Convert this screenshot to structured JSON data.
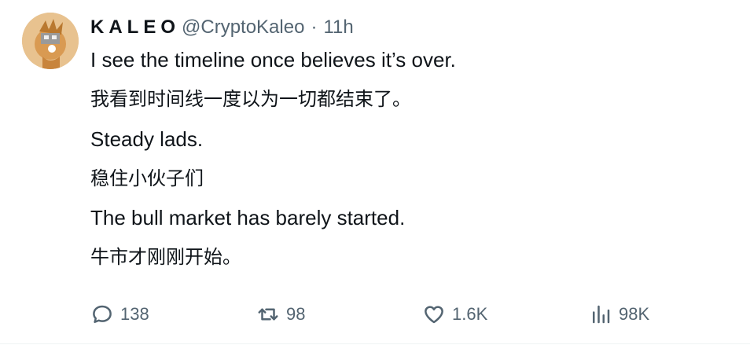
{
  "tweet": {
    "author": {
      "name": "KALEO",
      "handle": "@CryptoKaleo",
      "separator": "·",
      "time": "11h"
    },
    "lines": [
      "I see the timeline once believes it’s over.",
      "我看到时间线一度以为一切都结束了。",
      "Steady lads.",
      "稳住小伙子们",
      "The bull market has barely started.",
      "牛市才刚刚开始。"
    ],
    "actions": {
      "replies": "138",
      "retweets": "98",
      "likes": "1.6K",
      "views": "98K"
    }
  },
  "colors": {
    "text": "#0f1419",
    "secondary": "#536471",
    "avatar_bg": "#e9c79a"
  },
  "icons": {
    "reply": "speech-bubble-icon",
    "retweet": "retweet-arrows-icon",
    "like": "heart-icon",
    "views": "bar-chart-icon"
  }
}
